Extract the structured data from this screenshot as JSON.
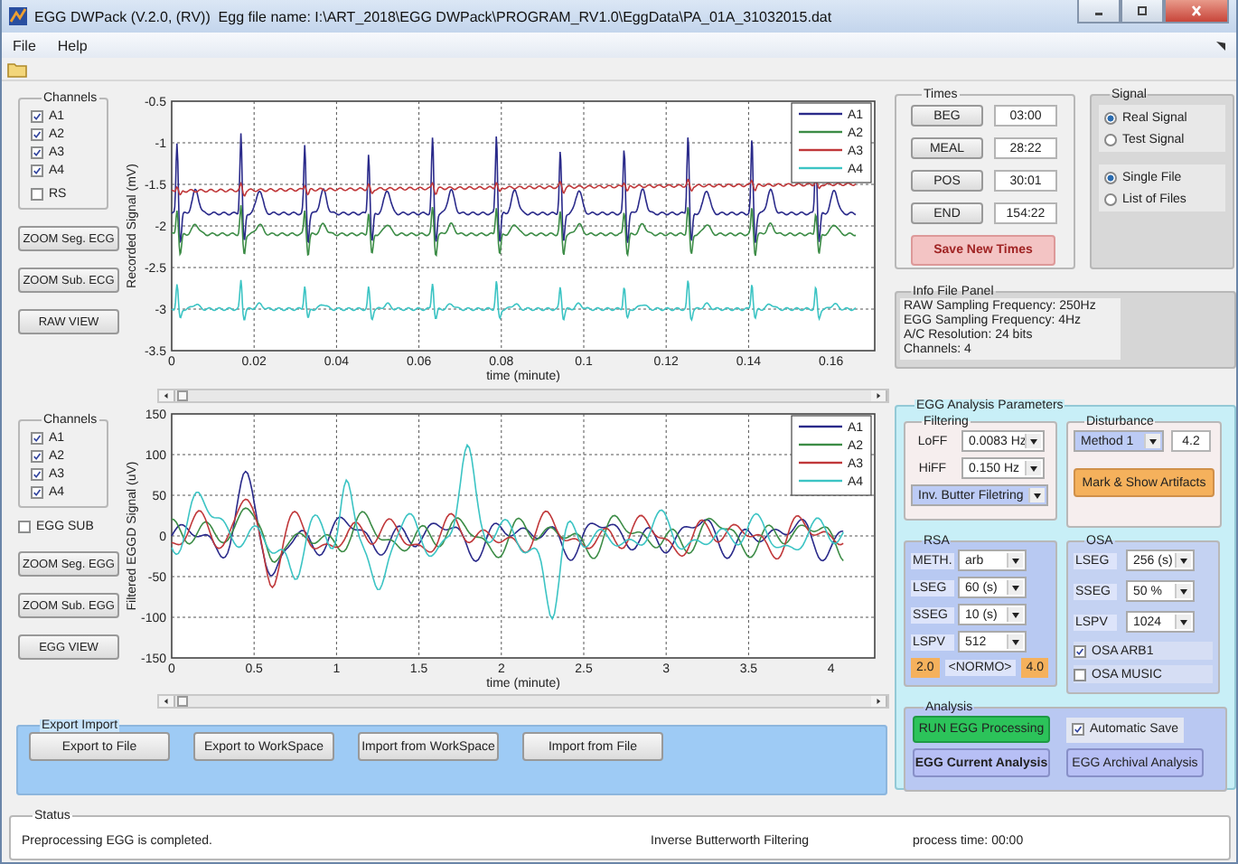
{
  "window": {
    "title": "EGG DWPack (V.2.0, (RV))  Egg file name: I:\\ART_2018\\EGG DWPack\\PROGRAM_RV1.0\\EggData\\PA_01A_31032015.dat"
  },
  "menu": [
    "File",
    "Help"
  ],
  "sections": [
    {
      "kind": "ecg",
      "channels_title": "Channels",
      "channels": [
        {
          "label": "A1",
          "checked": true
        },
        {
          "label": "A2",
          "checked": true
        },
        {
          "label": "A3",
          "checked": true
        },
        {
          "label": "A4",
          "checked": true
        },
        {
          "label": "RS",
          "checked": false
        }
      ],
      "buttons": [
        "ZOOM Seg. ECG",
        "ZOOM Sub. ECG",
        "RAW VIEW"
      ],
      "plot": {
        "ylabel": "Recorded Signal (mV)",
        "xlabel": "time (minute)",
        "yticks": [
          "-0.5",
          "-1",
          "-1.5",
          "-2",
          "-2.5",
          "-3",
          "-3.5"
        ],
        "xticks": [
          "0",
          "0.02",
          "0.04",
          "0.06",
          "0.08",
          "0.1",
          "0.12",
          "0.14",
          "0.16"
        ],
        "legend": [
          {
            "label": "A1",
            "color": "#2a2a8a"
          },
          {
            "label": "A2",
            "color": "#3c8c46"
          },
          {
            "label": "A3",
            "color": "#c0383a"
          },
          {
            "label": "A4",
            "color": "#3cc4c4"
          }
        ]
      }
    },
    {
      "kind": "egg",
      "channels_title": "Channels",
      "channels": [
        {
          "label": "A1",
          "checked": true
        },
        {
          "label": "A2",
          "checked": true
        },
        {
          "label": "A3",
          "checked": true
        },
        {
          "label": "A4",
          "checked": true
        }
      ],
      "extra_options": [
        {
          "label": "EGG SUB",
          "checked": false
        }
      ],
      "buttons": [
        "ZOOM Seg. EGG",
        "ZOOM Sub. EGG",
        "EGG VIEW"
      ],
      "plot": {
        "ylabel": "Filtered EGGD Signal (uV)",
        "xlabel": "time (minute)",
        "yticks": [
          "150",
          "100",
          "50",
          "0",
          "-50",
          "-100",
          "-150"
        ],
        "xticks": [
          "0",
          "0.5",
          "1",
          "1.5",
          "2",
          "2.5",
          "3",
          "3.5",
          "4"
        ],
        "legend": [
          {
            "label": "A1",
            "color": "#2a2a8a"
          },
          {
            "label": "A2",
            "color": "#3c8c46"
          },
          {
            "label": "A3",
            "color": "#c0383a"
          },
          {
            "label": "A4",
            "color": "#3cc4c4"
          }
        ]
      }
    }
  ],
  "export_import": {
    "title": "Export Import",
    "buttons": [
      "Export to File",
      "Export to WorkSpace",
      "Import from WorkSpace",
      "Import from File"
    ]
  },
  "times": {
    "title": "Times",
    "rows": [
      {
        "button": "BEG",
        "value": "03:00"
      },
      {
        "button": "MEAL",
        "value": "28:22"
      },
      {
        "button": "POS",
        "value": "30:01"
      },
      {
        "button": "END",
        "value": "154:22"
      }
    ],
    "save_button": "Save New Times"
  },
  "signal": {
    "title": "Signal",
    "sources": [
      {
        "label": "Real Signal",
        "selected": true
      },
      {
        "label": "Test Signal",
        "selected": false
      }
    ],
    "files": [
      {
        "label": "Single File",
        "selected": true
      },
      {
        "label": "List of Files",
        "selected": false
      }
    ]
  },
  "info": {
    "title": "Info File Panel",
    "lines": [
      "RAW Sampling Frequency: 250Hz",
      "EGG Sampling Frequency: 4Hz",
      "A/C Resolution: 24 bits",
      "Channels: 4"
    ]
  },
  "analysis_params": {
    "title": "EGG Analysis Parameters",
    "filtering": {
      "title": "Filtering",
      "rows": [
        {
          "label": "LoFF",
          "value": "0.0083 Hz"
        },
        {
          "label": "HiFF",
          "value": "0.150 Hz"
        }
      ],
      "method": "Inv. Butter Filetring"
    },
    "disturbance": {
      "title": "Disturbance",
      "method": "Method 1",
      "value": "4.2",
      "button": "Mark & Show Artifacts"
    },
    "rsa": {
      "title": "RSA",
      "rows": [
        {
          "label": "METH.",
          "value": "arb"
        },
        {
          "label": "LSEG",
          "value": "60 (s)"
        },
        {
          "label": "SSEG",
          "value": "10 (s)"
        },
        {
          "label": "LSPV",
          "value": "512"
        }
      ],
      "range_low": "2.0",
      "range_label": "<NORMO>",
      "range_high": "4.0"
    },
    "osa": {
      "title": "OSA",
      "rows": [
        {
          "label": "LSEG",
          "value": "256 (s)"
        },
        {
          "label": "SSEG",
          "value": "50 %"
        },
        {
          "label": "LSPV",
          "value": "1024"
        }
      ],
      "options": [
        {
          "label": "OSA ARB1",
          "checked": true
        },
        {
          "label": "OSA MUSIC",
          "checked": false
        }
      ]
    },
    "analysis": {
      "title": "Analysis",
      "run_button": "RUN EGG Processing",
      "auto_save": {
        "label": "Automatic Save",
        "checked": true
      },
      "current_button": "EGG Current Analysis",
      "archival_button": "EGG Archival Analysis"
    }
  },
  "status": {
    "title": "Status",
    "message": "Preprocessing EGG is completed.",
    "filter": "Inverse Butterworth Filtering",
    "process_time": "process time: 00:00"
  }
}
